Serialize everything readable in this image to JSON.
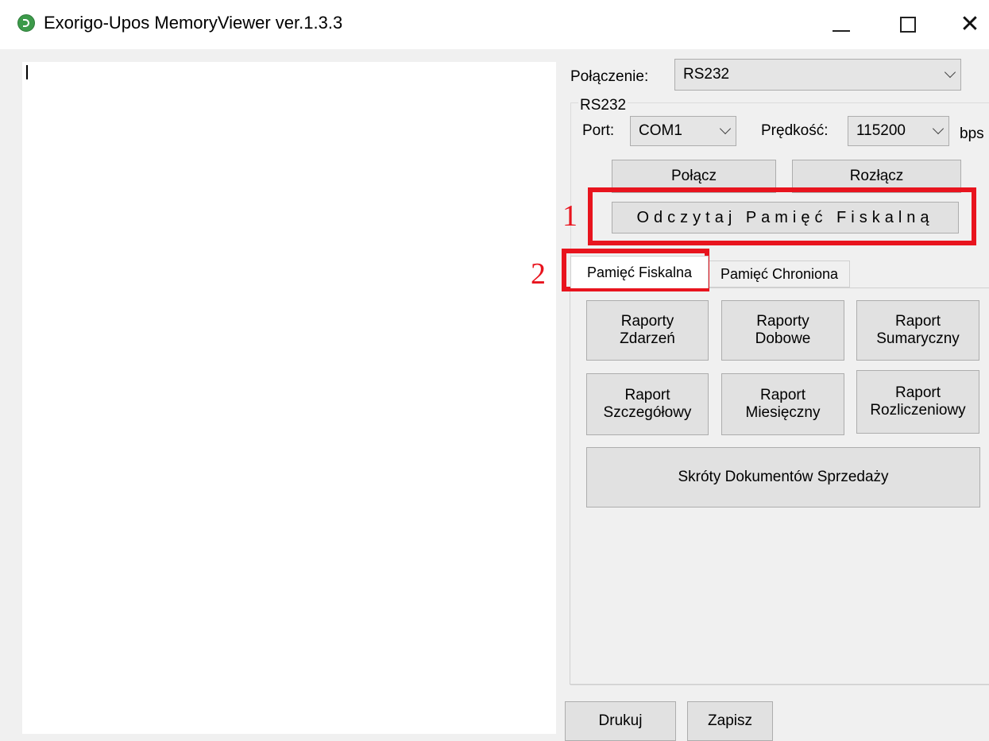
{
  "window": {
    "title": "Exorigo-Upos MemoryViewer ver.1.3.3",
    "icon": "app-logo-icon",
    "controls": {
      "minimize": "minimize-icon",
      "maximize": "maximize-icon",
      "close": "close-icon",
      "close_glyph": "✕"
    }
  },
  "connection": {
    "label": "Połączenie:",
    "value": "RS232"
  },
  "rs232": {
    "group_title": "RS232",
    "port_label": "Port:",
    "port_value": "COM1",
    "speed_label": "Prędkość:",
    "speed_value": "115200",
    "speed_unit": "bps",
    "connect_label": "Połącz",
    "disconnect_label": "Rozłącz",
    "read_memory_label": "Odczytaj Pamięć Fiskalną"
  },
  "tabs": [
    {
      "label": "Pamięć Fiskalna",
      "active": true
    },
    {
      "label": "Pamięć Chroniona",
      "active": false
    }
  ],
  "report_buttons": {
    "events": "Raporty\nZdarzeń",
    "daily": "Raporty\nDobowe",
    "summary": "Raport\nSumaryczny",
    "detailed": "Raport\nSzczegółowy",
    "monthly": "Raport\nMiesięczny",
    "settlement": "Raport\nRozliczeniowy",
    "sales_docs": "Skróty Dokumentów Sprzedaży"
  },
  "bottom": {
    "print_label": "Drukuj",
    "save_label": "Zapisz"
  },
  "annotations": {
    "one": "1",
    "two": "2",
    "color": "#e8141e"
  }
}
